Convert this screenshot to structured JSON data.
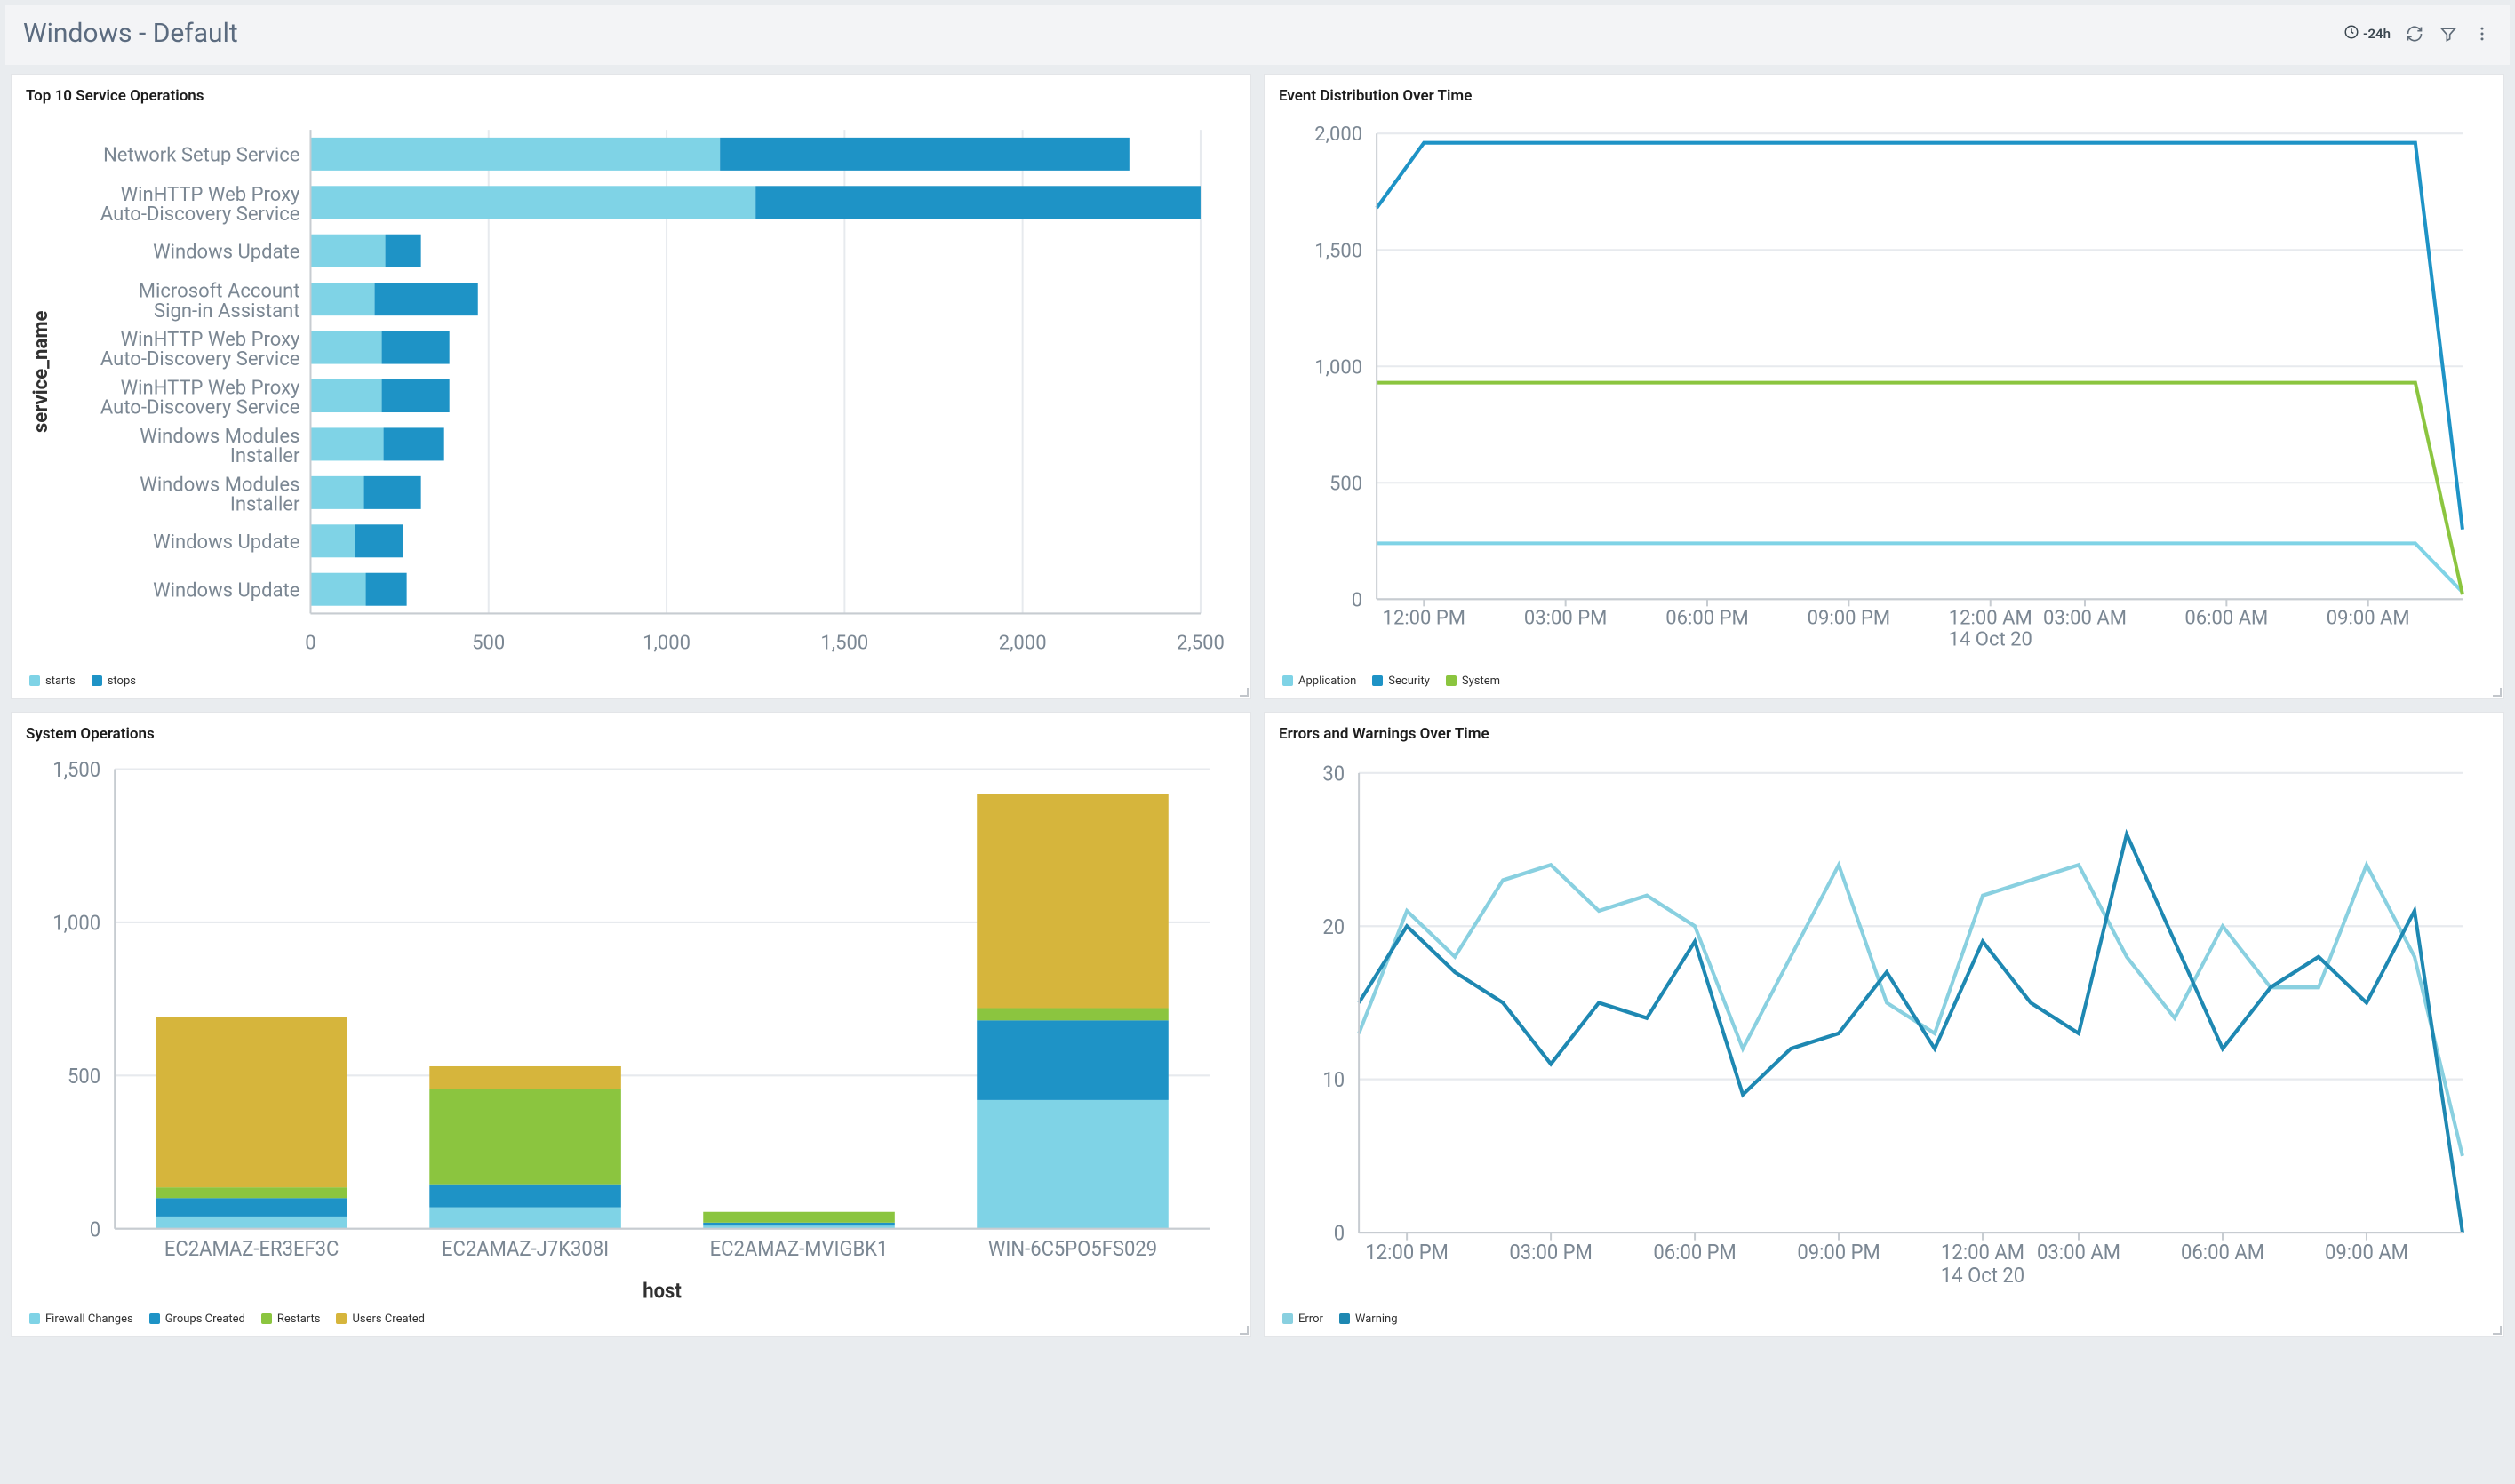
{
  "header": {
    "title": "Windows - Default",
    "time_range": "-24h"
  },
  "colors": {
    "lightblue": "#7fd3e6",
    "blue": "#1e93c6",
    "green": "#8bc53f",
    "olive": "#d6b53c",
    "seriesA": "#89d0e0",
    "seriesB": "#1e88b2"
  },
  "panels": {
    "top_services": {
      "title": "Top 10 Service Operations"
    },
    "event_dist": {
      "title": "Event Distribution Over Time"
    },
    "sys_ops": {
      "title": "System Operations"
    },
    "err_warn": {
      "title": "Errors and Warnings Over Time"
    }
  },
  "legends": {
    "top_services": [
      "starts",
      "stops"
    ],
    "event_dist": [
      "Application",
      "Security",
      "System"
    ],
    "sys_ops": [
      "Firewall Changes",
      "Groups Created",
      "Restarts",
      "Users Created"
    ],
    "err_warn": [
      "Error",
      "Warning"
    ]
  },
  "axis_labels": {
    "top_services_y": "service_name",
    "sys_ops_x": "host",
    "event_date": "14 Oct 20"
  },
  "chart_data": [
    {
      "id": "top_services",
      "type": "bar",
      "orientation": "horizontal",
      "stacked": true,
      "ylabel": "service_name",
      "xlabel": "",
      "xlim": [
        0,
        2500
      ],
      "xticks": [
        0,
        500,
        1000,
        1500,
        2000,
        2500
      ],
      "categories": [
        "Network Setup Service",
        "WinHTTP Web Proxy Auto-Discovery Service",
        "Windows Update",
        "Microsoft Account Sign-in Assistant",
        "WinHTTP Web Proxy Auto-Discovery Service",
        "WinHTTP Web Proxy Auto-Discovery Service",
        "Windows Modules Installer",
        "Windows Modules Installer",
        "Windows Update",
        "Windows Update"
      ],
      "series": [
        {
          "name": "starts",
          "color": "#7fd3e6",
          "values": [
            1150,
            1250,
            210,
            180,
            200,
            200,
            205,
            150,
            125,
            155
          ]
        },
        {
          "name": "stops",
          "color": "#1e93c6",
          "values": [
            1150,
            1250,
            100,
            290,
            190,
            190,
            170,
            160,
            135,
            115
          ]
        }
      ]
    },
    {
      "id": "event_dist",
      "type": "line",
      "ylabel": "",
      "ylim": [
        0,
        2000
      ],
      "yticks": [
        0,
        500,
        1000,
        1500,
        2000
      ],
      "xticks": [
        "12:00 PM",
        "03:00 PM",
        "06:00 PM",
        "09:00 PM",
        "12:00 AM",
        "03:00 AM",
        "06:00 AM",
        "09:00 AM"
      ],
      "x_subtitle": "14 Oct 20",
      "x": [
        0,
        1,
        2,
        3,
        4,
        5,
        6,
        7,
        8,
        9,
        10,
        11,
        12,
        13,
        14,
        15,
        16,
        17,
        18,
        19,
        20,
        21,
        22,
        23
      ],
      "series": [
        {
          "name": "Application",
          "color": "#7fd3e6",
          "values": [
            240,
            240,
            240,
            240,
            240,
            240,
            240,
            240,
            240,
            240,
            240,
            240,
            240,
            240,
            240,
            240,
            240,
            240,
            240,
            240,
            240,
            240,
            240,
            30
          ]
        },
        {
          "name": "Security",
          "color": "#1e93c6",
          "values": [
            1680,
            1960,
            1960,
            1960,
            1960,
            1960,
            1960,
            1960,
            1960,
            1960,
            1960,
            1960,
            1960,
            1960,
            1960,
            1960,
            1960,
            1960,
            1960,
            1960,
            1960,
            1960,
            1960,
            300
          ]
        },
        {
          "name": "System",
          "color": "#8bc53f",
          "values": [
            930,
            930,
            930,
            930,
            930,
            930,
            930,
            930,
            930,
            930,
            930,
            930,
            930,
            930,
            930,
            930,
            930,
            930,
            930,
            930,
            930,
            930,
            930,
            20
          ]
        }
      ]
    },
    {
      "id": "sys_ops",
      "type": "bar",
      "orientation": "vertical",
      "stacked": true,
      "xlabel": "host",
      "ylim": [
        0,
        1500
      ],
      "yticks": [
        0,
        500,
        1000,
        1500
      ],
      "categories": [
        "EC2AMAZ-ER3EF3C",
        "EC2AMAZ-J7K308I",
        "EC2AMAZ-MVIGBK1",
        "WIN-6C5PO5FS029"
      ],
      "series": [
        {
          "name": "Firewall Changes",
          "color": "#7fd3e6",
          "values": [
            40,
            70,
            10,
            420
          ]
        },
        {
          "name": "Groups Created",
          "color": "#1e93c6",
          "values": [
            60,
            75,
            10,
            260
          ]
        },
        {
          "name": "Restarts",
          "color": "#8bc53f",
          "values": [
            35,
            310,
            35,
            40
          ]
        },
        {
          "name": "Users Created",
          "color": "#d6b53c",
          "values": [
            555,
            75,
            0,
            700
          ]
        }
      ]
    },
    {
      "id": "err_warn",
      "type": "line",
      "ylim": [
        0,
        30
      ],
      "yticks": [
        0,
        10,
        20,
        30
      ],
      "xticks": [
        "12:00 PM",
        "03:00 PM",
        "06:00 PM",
        "09:00 PM",
        "12:00 AM",
        "03:00 AM",
        "06:00 AM",
        "09:00 AM"
      ],
      "x_subtitle": "14 Oct 20",
      "x": [
        0,
        1,
        2,
        3,
        4,
        5,
        6,
        7,
        8,
        9,
        10,
        11,
        12,
        13,
        14,
        15,
        16,
        17,
        18,
        19,
        20,
        21,
        22,
        23
      ],
      "series": [
        {
          "name": "Error",
          "color": "#89d0e0",
          "values": [
            13,
            21,
            18,
            23,
            24,
            21,
            22,
            20,
            12,
            18,
            24,
            15,
            13,
            22,
            23,
            24,
            18,
            14,
            20,
            16,
            16,
            24,
            18,
            5
          ]
        },
        {
          "name": "Warning",
          "color": "#1e88b2",
          "values": [
            15,
            20,
            17,
            15,
            11,
            15,
            14,
            19,
            9,
            12,
            13,
            17,
            12,
            19,
            15,
            13,
            26,
            19,
            12,
            16,
            18,
            15,
            21,
            0
          ]
        }
      ]
    }
  ]
}
